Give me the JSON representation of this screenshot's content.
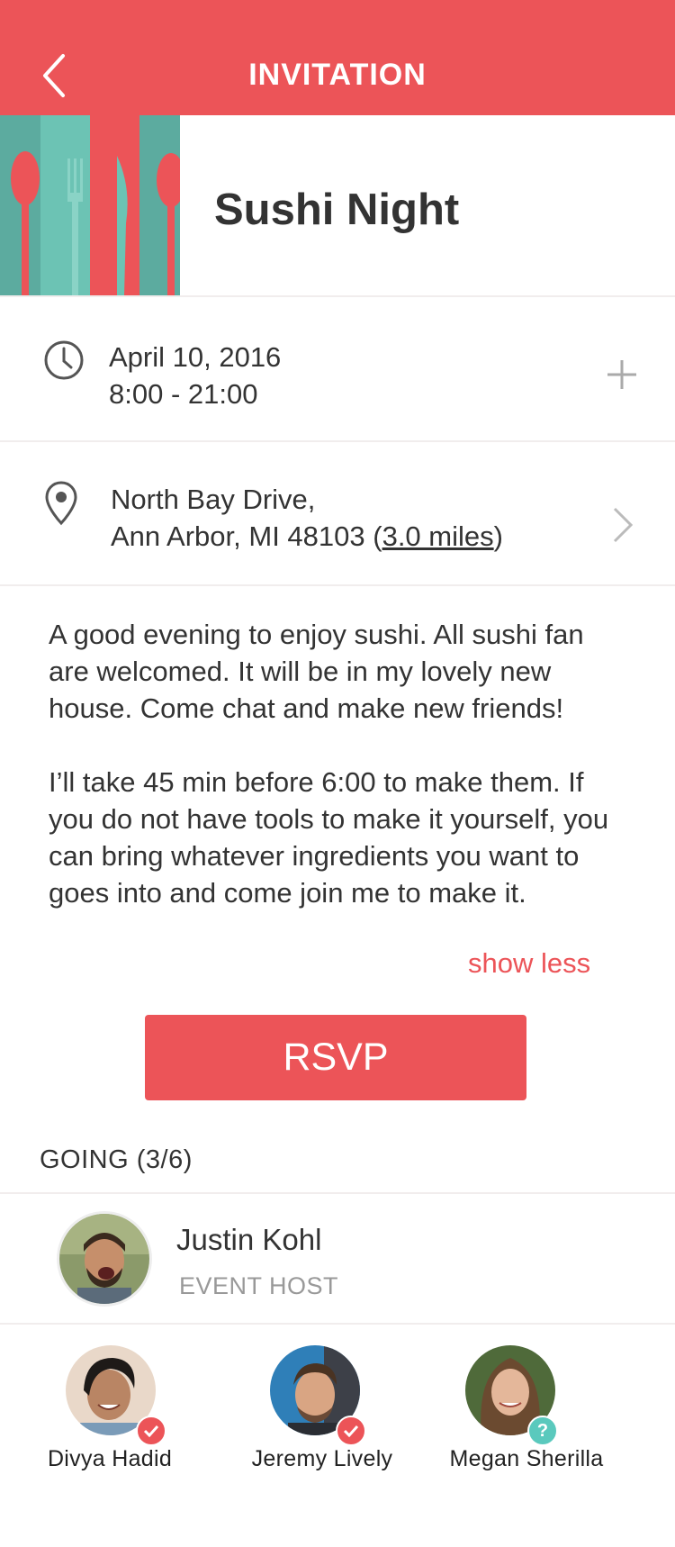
{
  "header": {
    "title": "INVITATION",
    "background_color": "#ec5458"
  },
  "event": {
    "title": "Sushi Night",
    "date": "April 10, 2016",
    "time": "8:00 - 21:00",
    "address_line1": "North Bay Drive,",
    "address_line2": "Ann Arbor, MI 48103",
    "distance": "3.0 miles",
    "description_p1": "A good evening to enjoy sushi. All sushi fan are welcomed. It will be in my lovely new house. Come chat and make new friends!",
    "description_p2": "I’ll take  45 min before 6:00 to make them. If you do not have tools to make it yourself, you can bring whatever ingredients you want to goes into and come join me to make it.",
    "show_less": "show less",
    "rsvp_label": "RSVP"
  },
  "attendees": {
    "title": "GOING (3/6)",
    "host": {
      "name": "Justin Kohl",
      "role": "EVENT HOST"
    },
    "guests": [
      {
        "name": "Divya Hadid",
        "status": "going",
        "badge_color": "#ec5458"
      },
      {
        "name": "Jeremy Lively",
        "status": "going",
        "badge_color": "#ec5458"
      },
      {
        "name": "Megan Sherilla",
        "status": "maybe",
        "badge_color": "#5ac9bd",
        "badge_text": "?"
      }
    ]
  },
  "icons": [
    "back-icon",
    "clock-icon",
    "plus-icon",
    "location-pin-icon",
    "chevron-right-icon",
    "check-icon",
    "question-icon"
  ],
  "colors": {
    "accent": "#ec5458",
    "teal": "#6cc3b4",
    "muted": "#999999"
  }
}
